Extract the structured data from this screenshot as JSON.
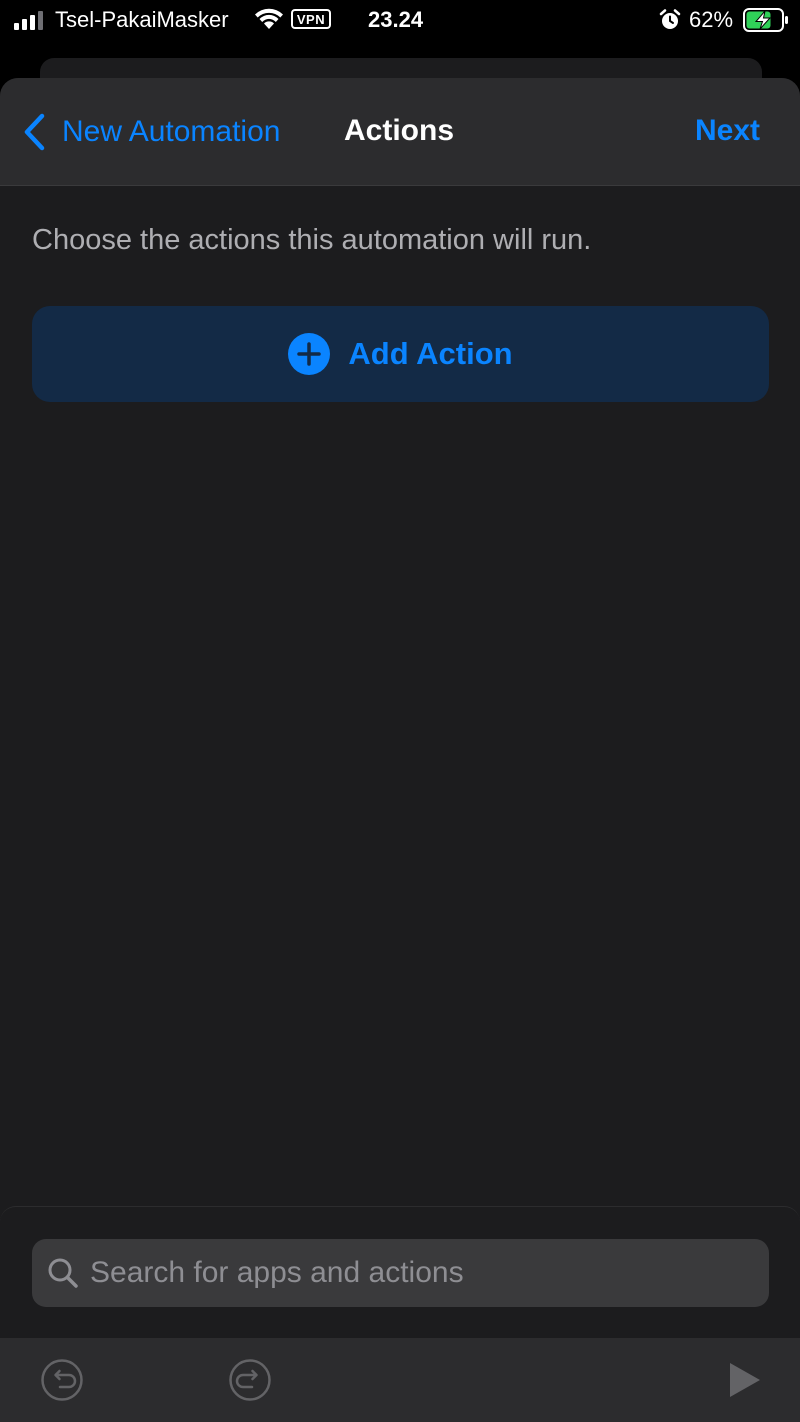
{
  "status_bar": {
    "carrier": "Tsel-PakaiMasker",
    "vpn": "VPN",
    "time": "23.24",
    "battery_percent": "62%",
    "signal_icon": "cellular-signal-icon",
    "wifi_icon": "wifi-icon",
    "alarm_icon": "alarm-clock-icon",
    "battery_icon": "battery-charging-icon"
  },
  "nav": {
    "back_label": "New Automation",
    "title": "Actions",
    "next_label": "Next"
  },
  "content": {
    "instructions": "Choose the actions this automation will run.",
    "add_action_label": "Add Action"
  },
  "search": {
    "placeholder": "Search for apps and actions"
  },
  "toolbar": {
    "undo_icon": "undo-icon",
    "redo_icon": "redo-icon",
    "play_icon": "play-icon"
  },
  "colors": {
    "accent": "#0a84ff",
    "background": "#1c1c1e",
    "nav_background": "#2c2c2e",
    "add_action_background": "#132a46",
    "search_background": "#3a3a3c",
    "secondary_text": "#aeaeb2",
    "placeholder_text": "#8e8e93"
  }
}
